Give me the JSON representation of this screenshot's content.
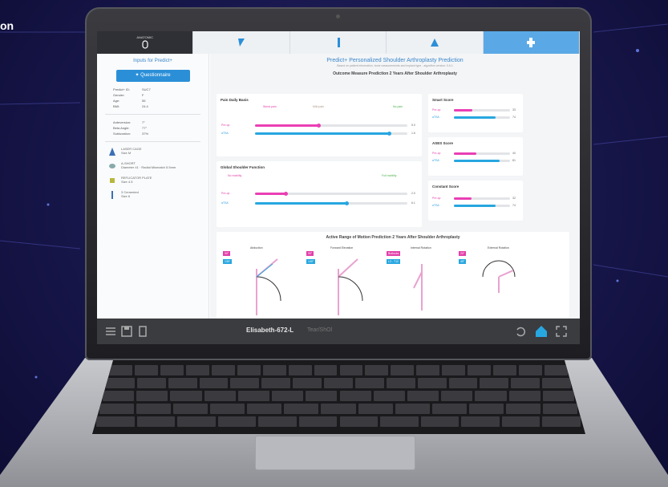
{
  "corner_text": "on",
  "tabs": [
    {
      "label": "ANATOMIC",
      "sub": "",
      "state": "dark"
    },
    {
      "label": "",
      "sub": "",
      "state": ""
    },
    {
      "label": "",
      "sub": "",
      "state": ""
    },
    {
      "label": "",
      "sub": "",
      "state": ""
    },
    {
      "label": "",
      "sub": "",
      "state": "active"
    }
  ],
  "left": {
    "title": "Inputs for Predict+",
    "button": "Questionnaire",
    "patient_info": [
      {
        "k": "Predict+ ID:",
        "v": "SUC7"
      },
      {
        "k": "Gender:",
        "v": "F"
      },
      {
        "k": "Age:",
        "v": "55"
      },
      {
        "k": "BMI:",
        "v": "24.4"
      }
    ],
    "angles": [
      {
        "k": "Anteversion:",
        "v": "7°"
      },
      {
        "k": "Beta Angle:",
        "v": "77°"
      },
      {
        "k": "Subluxation:",
        "v": "37%"
      }
    ],
    "implants": [
      {
        "name": "LASER CAGE",
        "detail": "Size M"
      },
      {
        "name": "A-SHORT",
        "detail": "Diameter 41 · Radial Mismatch 5.5mm"
      },
      {
        "name": "REFLICATOR PLATE",
        "detail": "Size 4.5"
      },
      {
        "name": "3 Cemented",
        "detail": "Size 6"
      }
    ]
  },
  "main": {
    "title": "Predict+ Personalized Shoulder Arthroplasty Prediction",
    "subtitle": "Based on patient information, bone measurements and implant type - algorithm version: 0.6.1",
    "outcome_title": "Outcome Measure Prediction 2 Years After Shoulder Arthroplasty",
    "rom_title": "Active Range of Motion Prediction 2 Years After Shoulder Arthroplasty",
    "pain": {
      "title": "Pain Daily Basis",
      "worst": "Worst pain",
      "mild": "Mild pain",
      "none": "No pain",
      "preop": "Pre-op",
      "post": "aTSA",
      "preop_val": "5.0",
      "post_val": "1.6",
      "preop_frac": 0.42,
      "post_frac": 0.88
    },
    "function": {
      "title": "Global Shoulder Function",
      "min": "No mobility",
      "max": "Full mobility",
      "preop": "Pre-op",
      "post": "aTSA",
      "preop_val": "2.0",
      "post_val": "6.1",
      "preop_frac": 0.2,
      "post_frac": 0.6
    },
    "smart": {
      "title": "Smart Score",
      "preop": "Pre-op",
      "post": "aTSA",
      "preop_val": "33",
      "post_val": "74",
      "preop_frac": 0.33,
      "post_frac": 0.74
    },
    "ases": {
      "title": "ASES Score",
      "preop": "Pre-op",
      "post": "aTSA",
      "preop_val": "40",
      "post_val": "81",
      "preop_frac": 0.4,
      "post_frac": 0.81
    },
    "constant": {
      "title": "Constant Score",
      "preop": "Pre-op",
      "post": "aTSA",
      "preop_val": "32",
      "post_val": "74",
      "preop_frac": 0.32,
      "post_frac": 0.74
    },
    "rom": [
      {
        "label": "Abduction",
        "a": "90°",
        "b": "135°"
      },
      {
        "label": "Forward Elevation",
        "a": "90°",
        "b": "140°"
      },
      {
        "label": "Internal Rotation",
        "a": "Buttocks",
        "b": "L3 - T12"
      },
      {
        "label": "External Rotation",
        "a": "20°",
        "b": "45°"
      }
    ]
  },
  "bottombar": {
    "patient": "Elisabeth-672-L",
    "subtitle": "Tear/ShOl"
  },
  "colors": {
    "accent": "#2b8fd8",
    "preop": "#ea3fb5",
    "post": "#27a7e0"
  }
}
